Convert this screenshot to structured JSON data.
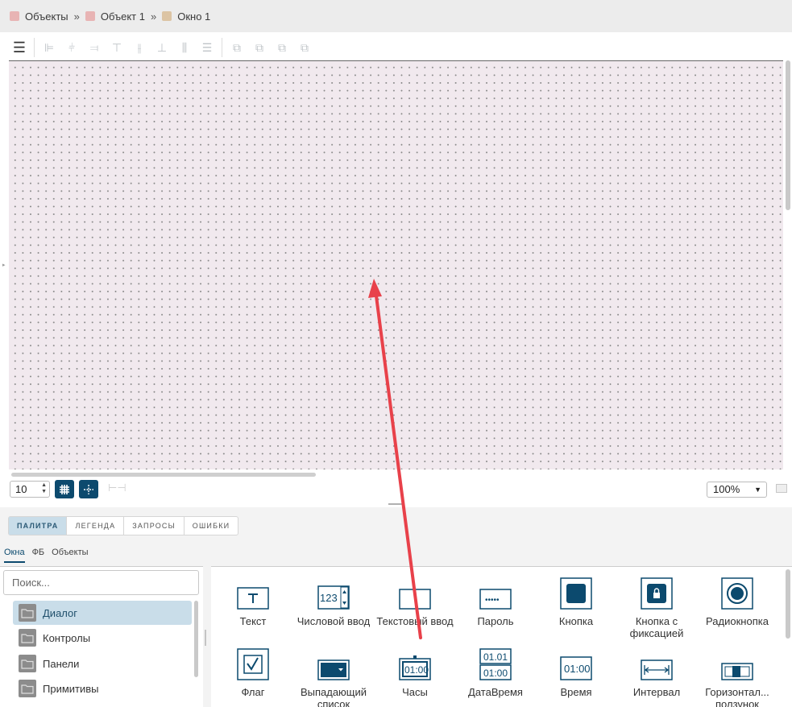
{
  "breadcrumb": [
    {
      "label": "Объекты",
      "color": "#e8b4b4"
    },
    {
      "label": "Объект 1",
      "color": "#e8b4b4"
    },
    {
      "label": "Окно 1",
      "color": "#dcc4a4"
    }
  ],
  "breadcrumb_separator": "»",
  "grid": {
    "size": "10"
  },
  "zoom": {
    "value": "100%"
  },
  "tabs": [
    {
      "label": "ПАЛИТРА",
      "active": true
    },
    {
      "label": "ЛЕГЕНДА",
      "active": false
    },
    {
      "label": "ЗАПРОСЫ",
      "active": false
    },
    {
      "label": "ОШИБКИ",
      "active": false
    }
  ],
  "subtabs": [
    {
      "label": "Окна",
      "active": true
    },
    {
      "label": "ФБ",
      "active": false
    },
    {
      "label": "Объекты",
      "active": false
    }
  ],
  "search": {
    "placeholder": "Поиск..."
  },
  "categories": [
    {
      "label": "Диалог",
      "active": true
    },
    {
      "label": "Контролы",
      "active": false
    },
    {
      "label": "Панели",
      "active": false
    },
    {
      "label": "Примитивы",
      "active": false
    }
  ],
  "palette_items": [
    {
      "label": "Текст",
      "icon": "text-icon"
    },
    {
      "label": "Числовой ввод",
      "icon": "numeric-input-icon"
    },
    {
      "label": "Текстовый ввод",
      "icon": "text-input-icon"
    },
    {
      "label": "Пароль",
      "icon": "password-icon"
    },
    {
      "label": "Кнопка",
      "icon": "button-icon"
    },
    {
      "label": "Кнопка с фиксацией",
      "icon": "toggle-button-icon"
    },
    {
      "label": "Радиокнопка",
      "icon": "radio-button-icon"
    },
    {
      "label": "Флаг",
      "icon": "checkbox-icon"
    },
    {
      "label": "Выпадающий список",
      "icon": "dropdown-icon"
    },
    {
      "label": "Часы",
      "icon": "clock-icon"
    },
    {
      "label": "ДатаВремя",
      "icon": "datetime-icon"
    },
    {
      "label": "Время",
      "icon": "time-icon"
    },
    {
      "label": "Интервал",
      "icon": "interval-icon"
    },
    {
      "label": "Горизонтал... ползунок",
      "icon": "horizontal-slider-icon"
    }
  ],
  "icon_texts": {
    "numeric": "123",
    "clock": "01:00",
    "date": "01.01",
    "time": "01:00",
    "password": "•••••"
  },
  "colors": {
    "accent": "#0c4a6e",
    "selection": "#c9dde9",
    "canvas": "#f1e9ee",
    "annotation_arrow": "#e8414a"
  }
}
